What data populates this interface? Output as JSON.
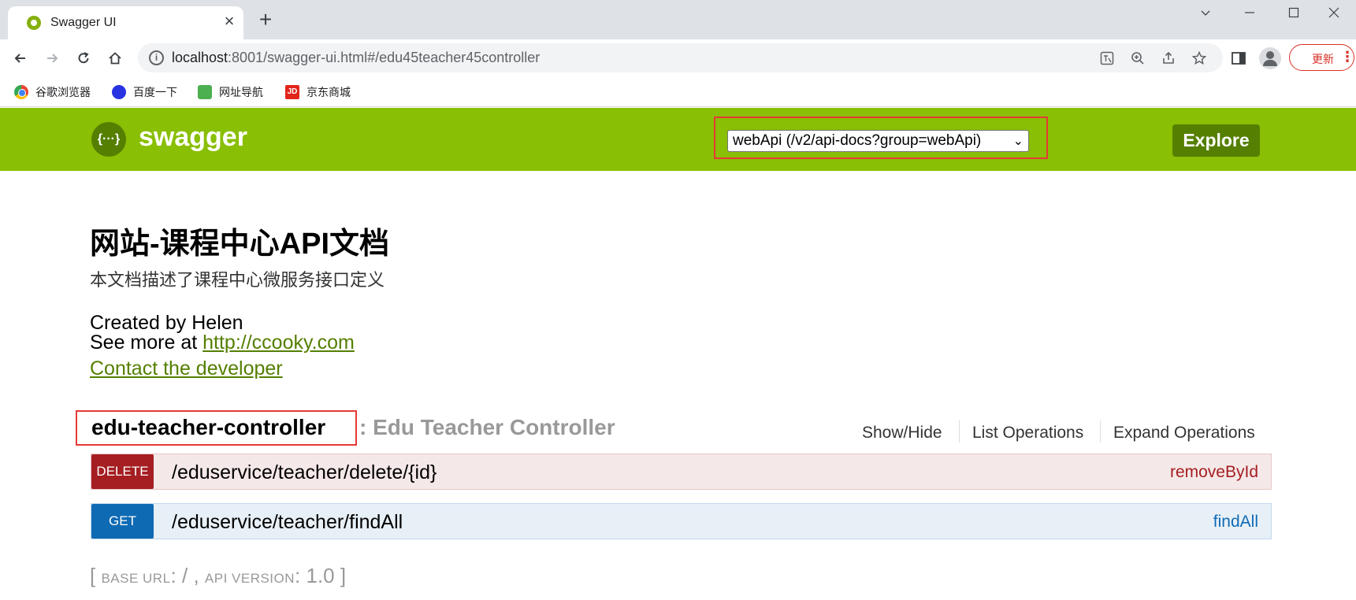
{
  "browser": {
    "tab_title": "Swagger UI",
    "new_tab_symbol": "+",
    "close_symbol": "×",
    "url_host": "localhost",
    "url_path": ":8001/swagger-ui.html#/edu45teacher45controller",
    "update_label": "更新",
    "bookmarks": [
      "谷歌浏览器",
      "百度一下",
      "网址导航",
      "京东商城"
    ],
    "jd_icon_text": "JD"
  },
  "swagger": {
    "logo_text": "{···}",
    "brand": "swagger",
    "api_selector": "webApi (/v2/api-docs?group=webApi)",
    "explore_label": "Explore",
    "brand_color": "#89bf04"
  },
  "info": {
    "title": "网站-课程中心API文档",
    "description": "本文档描述了课程中心微服务接口定义",
    "created_by": "Created by Helen",
    "see_more_prefix": "See more at ",
    "see_more_link": "http://ccooky.com",
    "contact": "Contact the developer"
  },
  "controller": {
    "name": "edu-teacher-controller",
    "description": ": Edu Teacher Controller",
    "actions": [
      "Show/Hide",
      "List Operations",
      "Expand Operations"
    ],
    "operations": [
      {
        "method": "DELETE",
        "path": "/eduservice/teacher/delete/{id}",
        "nickname": "removeById",
        "color": "#a41e22"
      },
      {
        "method": "GET",
        "path": "/eduservice/teacher/findAll",
        "nickname": "findAll",
        "color": "#0f6ab4"
      }
    ]
  },
  "footer": {
    "open_bracket": "[ ",
    "base_url_label": "BASE URL",
    "base_url_value": ": / , ",
    "api_version_label": "API VERSION",
    "api_version_value": ": 1.0 ]"
  }
}
